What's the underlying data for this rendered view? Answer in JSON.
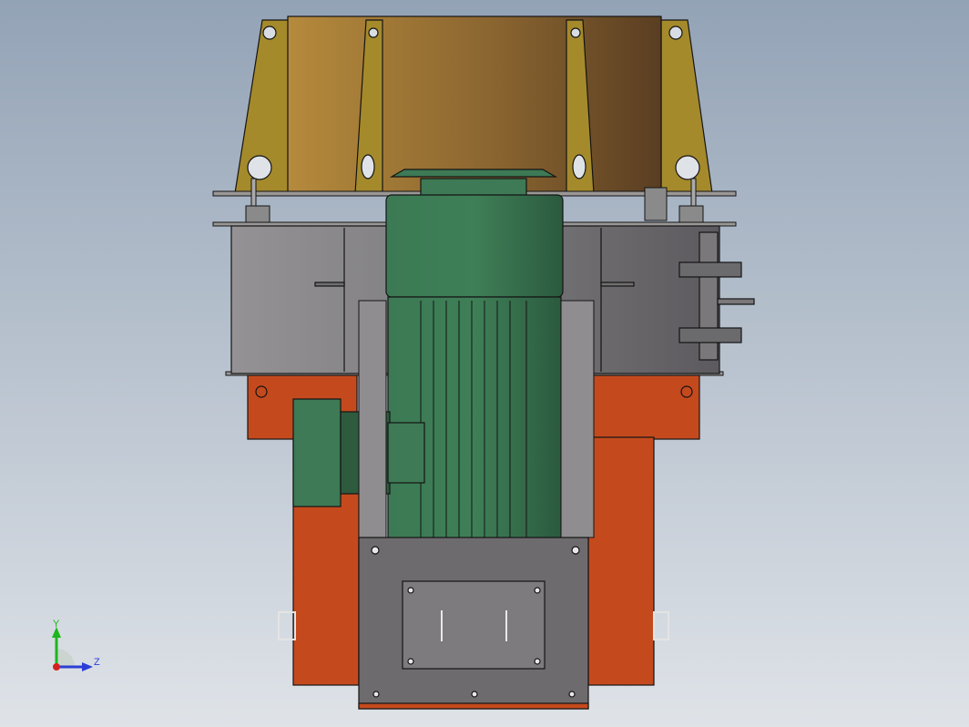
{
  "viewport": {
    "background_top": "#93a3b6",
    "background_bottom": "#dfe3e8"
  },
  "triad": {
    "y_label": "Y",
    "z_label": "Z",
    "y_color": "#1db61d",
    "z_color": "#2b3fd6",
    "x_color": "#d62020"
  },
  "colors": {
    "brass": "#a58a2c",
    "brass_shell": "#b08a3a",
    "steel_gray": "#8c8a8c",
    "motor_green": "#3d7a55",
    "housing_orange": "#c44a1e",
    "base_plate": "#6d6b6d",
    "outline": "#141414"
  }
}
